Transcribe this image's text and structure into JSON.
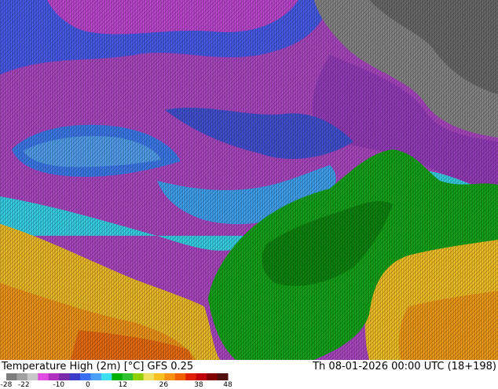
{
  "map": {
    "product": "Temperature High (2m) [°C] GFS 0.25",
    "title_text": "Temperature High (2m) [°C]",
    "model": "GFS 0.25",
    "valid_time": "Th 08-01-2026 00:00 UTC (18+198)"
  },
  "legend": {
    "unit": "°C",
    "ticks": [
      "-28",
      "-22",
      "-10",
      "0",
      "12",
      "26",
      "38",
      "48"
    ],
    "tick_values": [
      -28,
      -22,
      -10,
      0,
      12,
      26,
      38,
      48
    ],
    "colors": [
      "#7d7d7d",
      "#a0a0a0",
      "#c8c8c8",
      "#e04ce0",
      "#b030c0",
      "#7a2aa8",
      "#3c3cc8",
      "#3a6ef0",
      "#4aa0f5",
      "#3ce0f0",
      "#00b000",
      "#30c030",
      "#90d000",
      "#f0e060",
      "#f8c020",
      "#f89010",
      "#f06000",
      "#e02000",
      "#c00000",
      "#800000",
      "#501010"
    ]
  }
}
